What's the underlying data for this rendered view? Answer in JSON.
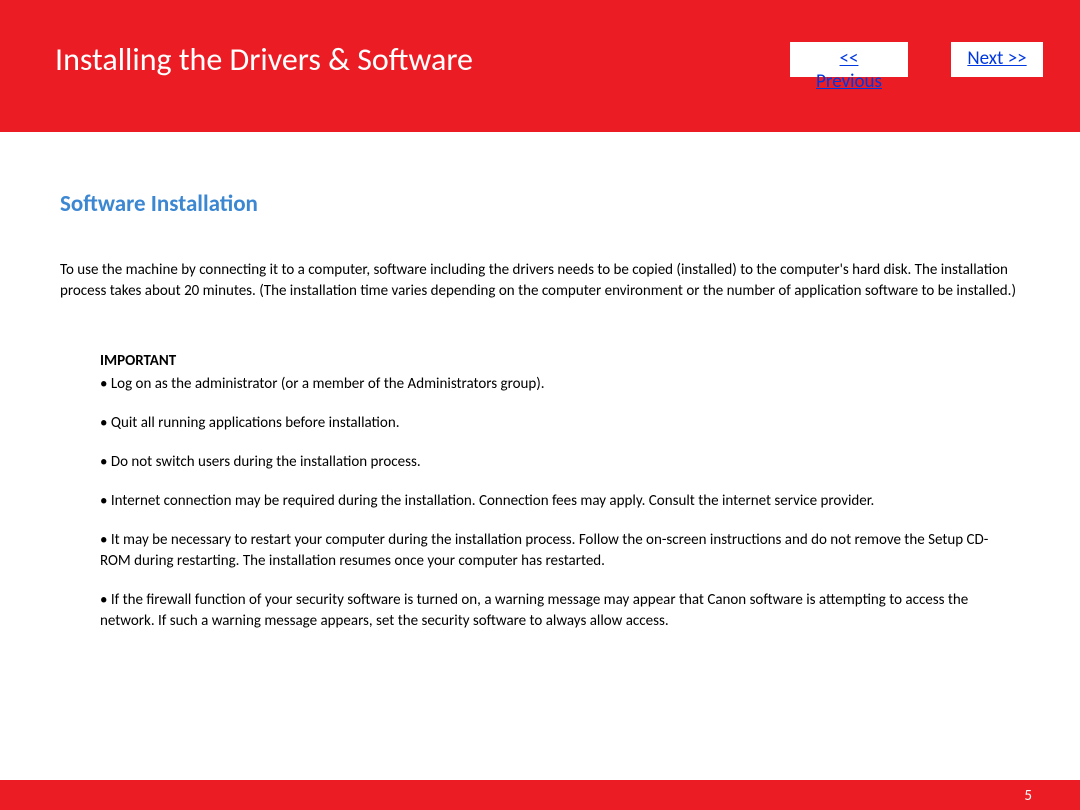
{
  "header": {
    "title": "Installing  the Drivers & Software",
    "prev_label": " << Previous",
    "next_label": "Next >>"
  },
  "section": {
    "heading": "Software Installation",
    "intro": "To use the machine by connecting it to a computer, software including the drivers needs to be copied (installed) to the computer's hard disk. The installation process takes about 20 minutes. (The installation time varies depending on the computer environment or the number of application software to be installed.)",
    "important_label": "IMPORTANT",
    "bullets": [
      "• Log on as the administrator (or a member of the Administrators group).",
      "• Quit all running applications before installation.",
      "• Do not switch users during the installation process.",
      "• Internet connection may be required during the installation. Connection fees may apply. Consult the internet service provider.",
      "• It may be necessary to restart your computer during the installation process. Follow the on-screen instructions and do not remove the Setup CD-ROM during restarting. The installation resumes once your computer has restarted.",
      "• If the firewall function of your security software is turned on, a warning message may appear that Canon software is attempting to access the network. If such a warning message appears, set the security software to always allow access."
    ]
  },
  "footer": {
    "page_number": "5"
  }
}
